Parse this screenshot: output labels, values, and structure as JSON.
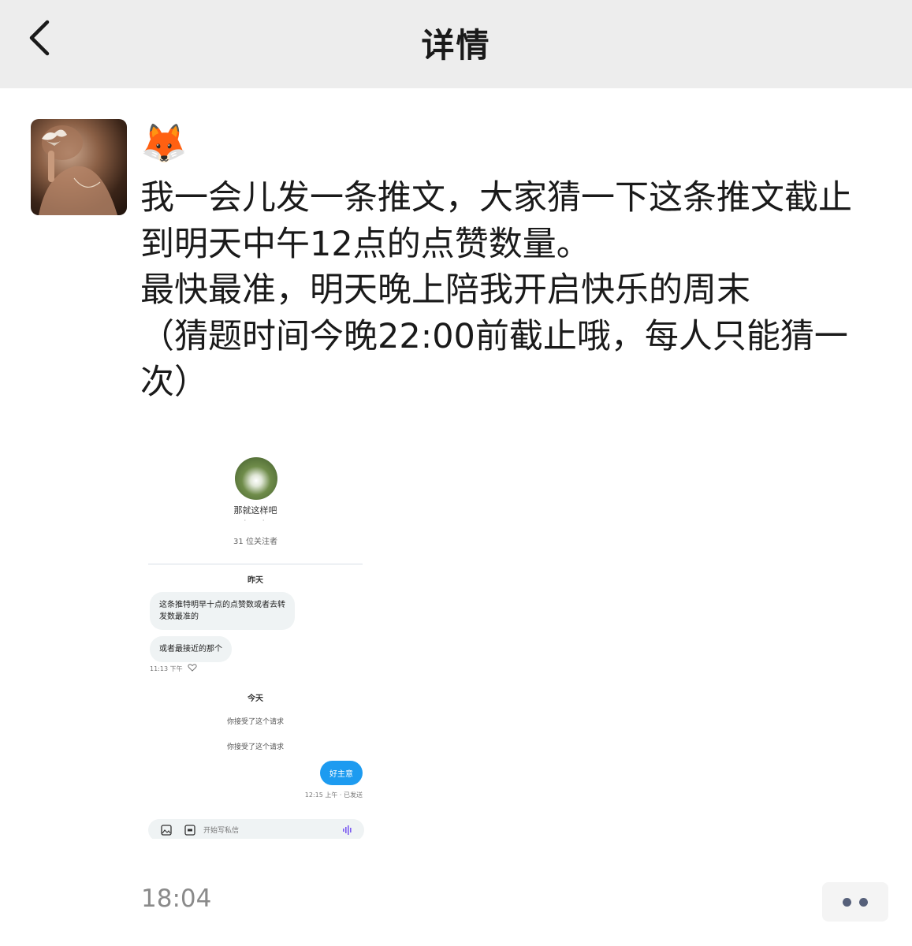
{
  "header": {
    "title": "详情",
    "back_icon": "chevron-left-icon"
  },
  "post": {
    "nickname_emoji": "🦊",
    "lines": [
      "我一会儿发一条推文，大家猜一下这条推文截止",
      "到明天中午12点的点赞数量。",
      "最快最准，明天晚上陪我开启快乐的周末",
      "（猜题时间今晚22:00前截止哦，每人只能猜一",
      "次）"
    ],
    "timestamp": "18:04",
    "more_icon": "more-dots-icon"
  },
  "screenshot": {
    "profile_name": "那就这样吧",
    "handle": "·   ·",
    "followers": "31 位关注者",
    "day1": "昨天",
    "msg1_line1": "这条推特明早十点的点赞数或者去转",
    "msg1_line2": "发数最准的",
    "msg2": "或者最接近的那个",
    "time1": "11:13 下午",
    "day2": "今天",
    "accepted1": "你接受了这个请求",
    "accepted2": "你接受了这个请求",
    "my_reply": "好主意",
    "time2": "12:15 上午 · 已发送",
    "composer_placeholder": "开始写私信"
  }
}
